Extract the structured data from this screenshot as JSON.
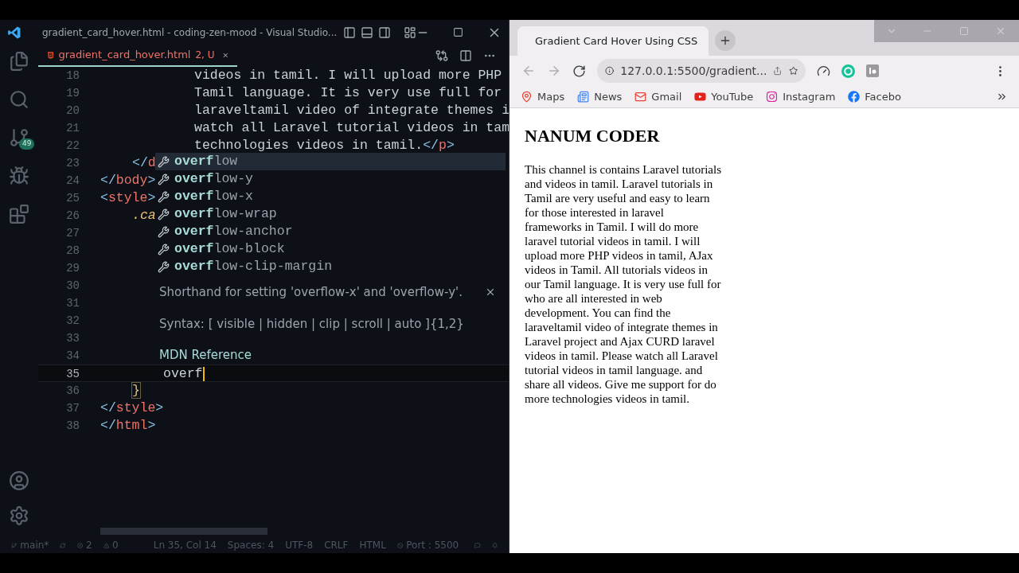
{
  "editor": {
    "title": "gradient_card_hover.html - coding-zen-mood - Visual Studio...",
    "source_control_badge": "49",
    "tab": {
      "label": "gradient_card_hover.html",
      "status": "2, U"
    },
    "lines": [
      {
        "number": "18",
        "selected": false,
        "kind": "prose",
        "tokens": [
          {
            "kind": "text",
            "text": "videos in tamil. I will upload more PHP"
          }
        ]
      },
      {
        "number": "19",
        "selected": false,
        "kind": "prose",
        "tokens": [
          {
            "kind": "text",
            "text": "Tamil language. It is very use full for"
          }
        ]
      },
      {
        "number": "20",
        "selected": false,
        "kind": "prose",
        "tokens": [
          {
            "kind": "text",
            "text": "laraveltamil video of integrate themes i"
          }
        ]
      },
      {
        "number": "21",
        "selected": false,
        "kind": "prose",
        "tokens": [
          {
            "kind": "text",
            "text": "watch all Laravel tutorial videos in tam"
          }
        ]
      },
      {
        "number": "22",
        "selected": false,
        "kind": "prose",
        "tokens": [
          {
            "kind": "text",
            "text": "technologies videos in tamil."
          },
          {
            "kind": "punct",
            "text": "</"
          },
          {
            "kind": "tag",
            "text": "p"
          },
          {
            "kind": "punct",
            "text": ">"
          }
        ]
      },
      {
        "number": "23",
        "selected": false,
        "kind": "inner",
        "tokens": [
          {
            "kind": "punct",
            "text": "</"
          },
          {
            "kind": "tag",
            "text": "d"
          }
        ]
      },
      {
        "number": "24",
        "selected": false,
        "kind": "top",
        "tokens": [
          {
            "kind": "punct",
            "text": "</"
          },
          {
            "kind": "tag",
            "text": "body"
          },
          {
            "kind": "punct",
            "text": ">"
          }
        ]
      },
      {
        "number": "25",
        "selected": false,
        "kind": "top",
        "tokens": [
          {
            "kind": "punct",
            "text": "<"
          },
          {
            "kind": "tag",
            "text": "style"
          },
          {
            "kind": "punct",
            "text": ">"
          }
        ]
      },
      {
        "number": "26",
        "selected": false,
        "kind": "inner",
        "tokens": [
          {
            "kind": "selector",
            "text": ".ca"
          }
        ]
      },
      {
        "number": "27",
        "selected": false
      },
      {
        "number": "28",
        "selected": false
      },
      {
        "number": "29",
        "selected": false
      },
      {
        "number": "30",
        "selected": false
      },
      {
        "number": "31",
        "selected": false
      },
      {
        "number": "32",
        "selected": false
      },
      {
        "number": "33",
        "selected": false
      },
      {
        "number": "34",
        "selected": false
      },
      {
        "number": "35",
        "selected": true,
        "kind": "property",
        "tokens": [
          {
            "kind": "text",
            "text": "overf"
          }
        ]
      },
      {
        "number": "36",
        "selected": false,
        "kind": "inner",
        "tokens": [
          {
            "kind": "brace",
            "text": "}"
          }
        ]
      },
      {
        "number": "37",
        "selected": false,
        "kind": "top",
        "tokens": [
          {
            "kind": "punct",
            "text": "</"
          },
          {
            "kind": "tag",
            "text": "style"
          },
          {
            "kind": "punct",
            "text": ">"
          }
        ]
      },
      {
        "number": "38",
        "selected": false,
        "kind": "top",
        "tokens": [
          {
            "kind": "punct",
            "text": "</"
          },
          {
            "kind": "tag",
            "text": "html"
          },
          {
            "kind": "punct",
            "text": ">"
          }
        ]
      }
    ],
    "suggestions": [
      {
        "text": "**overf**low",
        "selected": true
      },
      {
        "text": "**overf**low-y",
        "selected": false
      },
      {
        "text": "**overf**low-x",
        "selected": false
      },
      {
        "text": "**overf**low-wrap",
        "selected": false
      },
      {
        "text": "**overf**low-anchor",
        "selected": false
      },
      {
        "text": "**overf**low-block",
        "selected": false
      },
      {
        "text": "**overf**low-clip-margin",
        "selected": false
      }
    ],
    "hover": {
      "description": "Shorthand for setting 'overflow-x' and 'overflow-y'.",
      "syntax": "Syntax: [ visible | hidden | clip | scroll | auto ]{1,2}",
      "link": "MDN Reference"
    },
    "status_bar": {
      "branch": "main*",
      "errors": "2",
      "warnings": "0",
      "position": "Ln 35, Col 14",
      "spaces": "Spaces: 4",
      "encoding": "UTF-8",
      "eol": "CRLF",
      "language": "HTML",
      "port": "Port : 5500"
    }
  },
  "browser": {
    "tab_title": "Gradient Card Hover Using CSS",
    "url": "127.0.0.1:5500/gradient...",
    "bookmarks": [
      {
        "kind": "maps",
        "label": "Maps"
      },
      {
        "kind": "news",
        "label": "News"
      },
      {
        "kind": "gmail",
        "label": "Gmail"
      },
      {
        "kind": "youtube",
        "label": "YouTube"
      },
      {
        "kind": "instagram",
        "label": "Instagram"
      },
      {
        "kind": "facebook",
        "label": "Facebo"
      }
    ],
    "page": {
      "heading": "NANUM CODER",
      "paragraph": "This channel is contains Laravel tutorials and videos in tamil. Laravel tutorials in Tamil are very useful and easy to learn for those interested in laravel frameworks in Tamil. I will do more laravel tutorial videos in tamil. I will upload more PHP videos in tamil, AJax videos in Tamil. All tutorials videos in our Tamil language. It is very use full for who are all interested in web development. You can find the laraveltamil video of integrate themes in Laravel project and Ajax CURD laravel videos in tamil. Please watch all Laravel tutorial videos in tamil language. and share all videos. Give me support for do more technologies videos in tamil."
    }
  }
}
